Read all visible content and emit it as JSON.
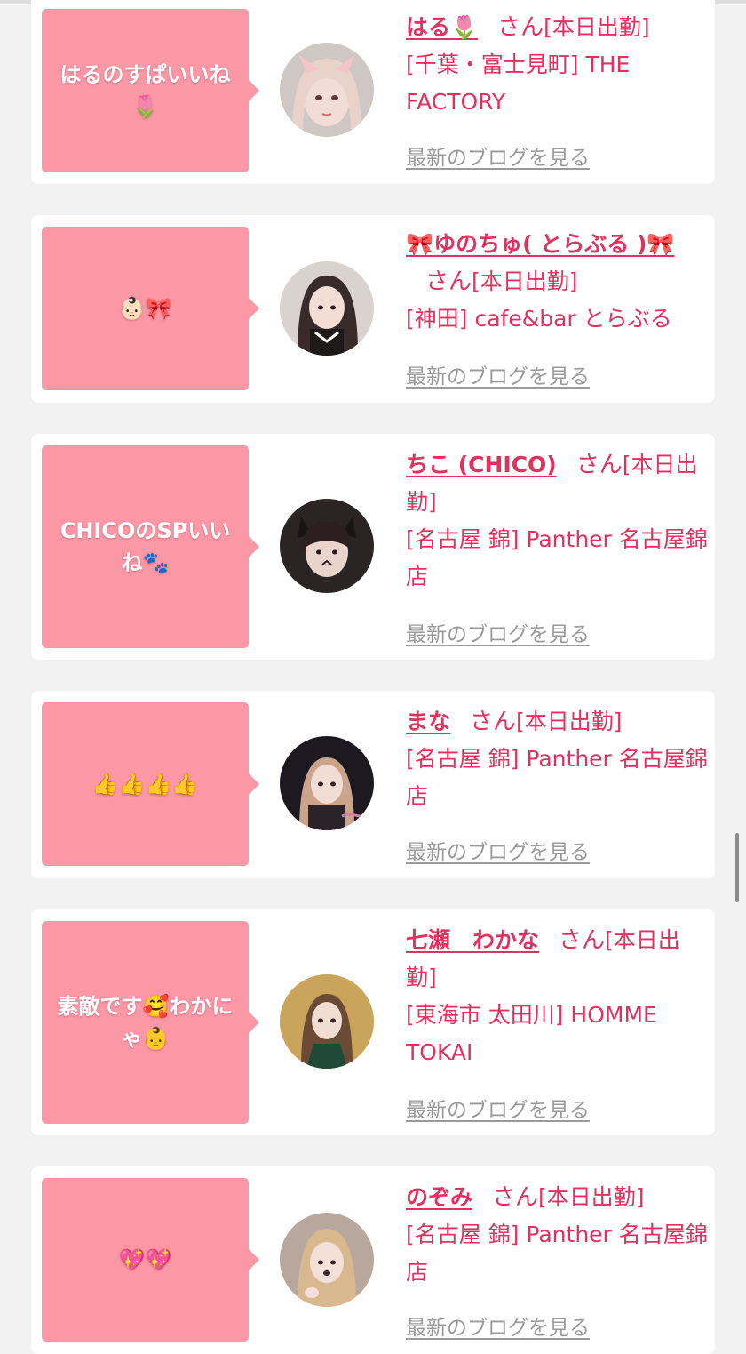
{
  "posts": [
    {
      "bubble_text": "はるのすぱいいね🌷",
      "name": "はる🌷",
      "honorific": "さん",
      "status": "[本日出勤]",
      "shop": "[千葉・富士見町] THE FACTORY",
      "blog_link": "最新のブログを見る"
    },
    {
      "bubble_text": "👶🏻🎀",
      "name": "🎀ゆのちゅ( とらぶる )🎀",
      "honorific": "さん",
      "status": "[本日出勤]",
      "shop": "[神田] cafe&bar とらぶる",
      "blog_link": "最新のブログを見る"
    },
    {
      "bubble_text": "CHICOのSPいいね🐾",
      "name": "ちこ (CHICO)",
      "honorific": "さん",
      "status": "[本日出勤]",
      "shop": "[名古屋 錦] Panther 名古屋錦店",
      "blog_link": "最新のブログを見る"
    },
    {
      "bubble_text": "👍👍👍👍",
      "name": "まな",
      "honorific": "さん",
      "status": "[本日出勤]",
      "shop": "[名古屋 錦] Panther 名古屋錦店",
      "blog_link": "最新のブログを見る"
    },
    {
      "bubble_text": "素敵です🥰わかにゃ👶",
      "name": "七瀬　わかな",
      "honorific": "さん",
      "status": "[本日出勤]",
      "shop": "[東海市 太田川] HOMME TOKAI",
      "blog_link": "最新のブログを見る"
    },
    {
      "bubble_text": "💖💖",
      "name": "のぞみ",
      "honorific": "さん",
      "status": "[本日出勤]",
      "shop": "[名古屋 錦] Panther 名古屋錦店",
      "blog_link": "最新のブログを見る"
    }
  ],
  "colors": {
    "bubble": "#fc97a6",
    "accent": "#e1315f",
    "link_gray": "#9a9a9a",
    "background": "#f2f2f2"
  }
}
